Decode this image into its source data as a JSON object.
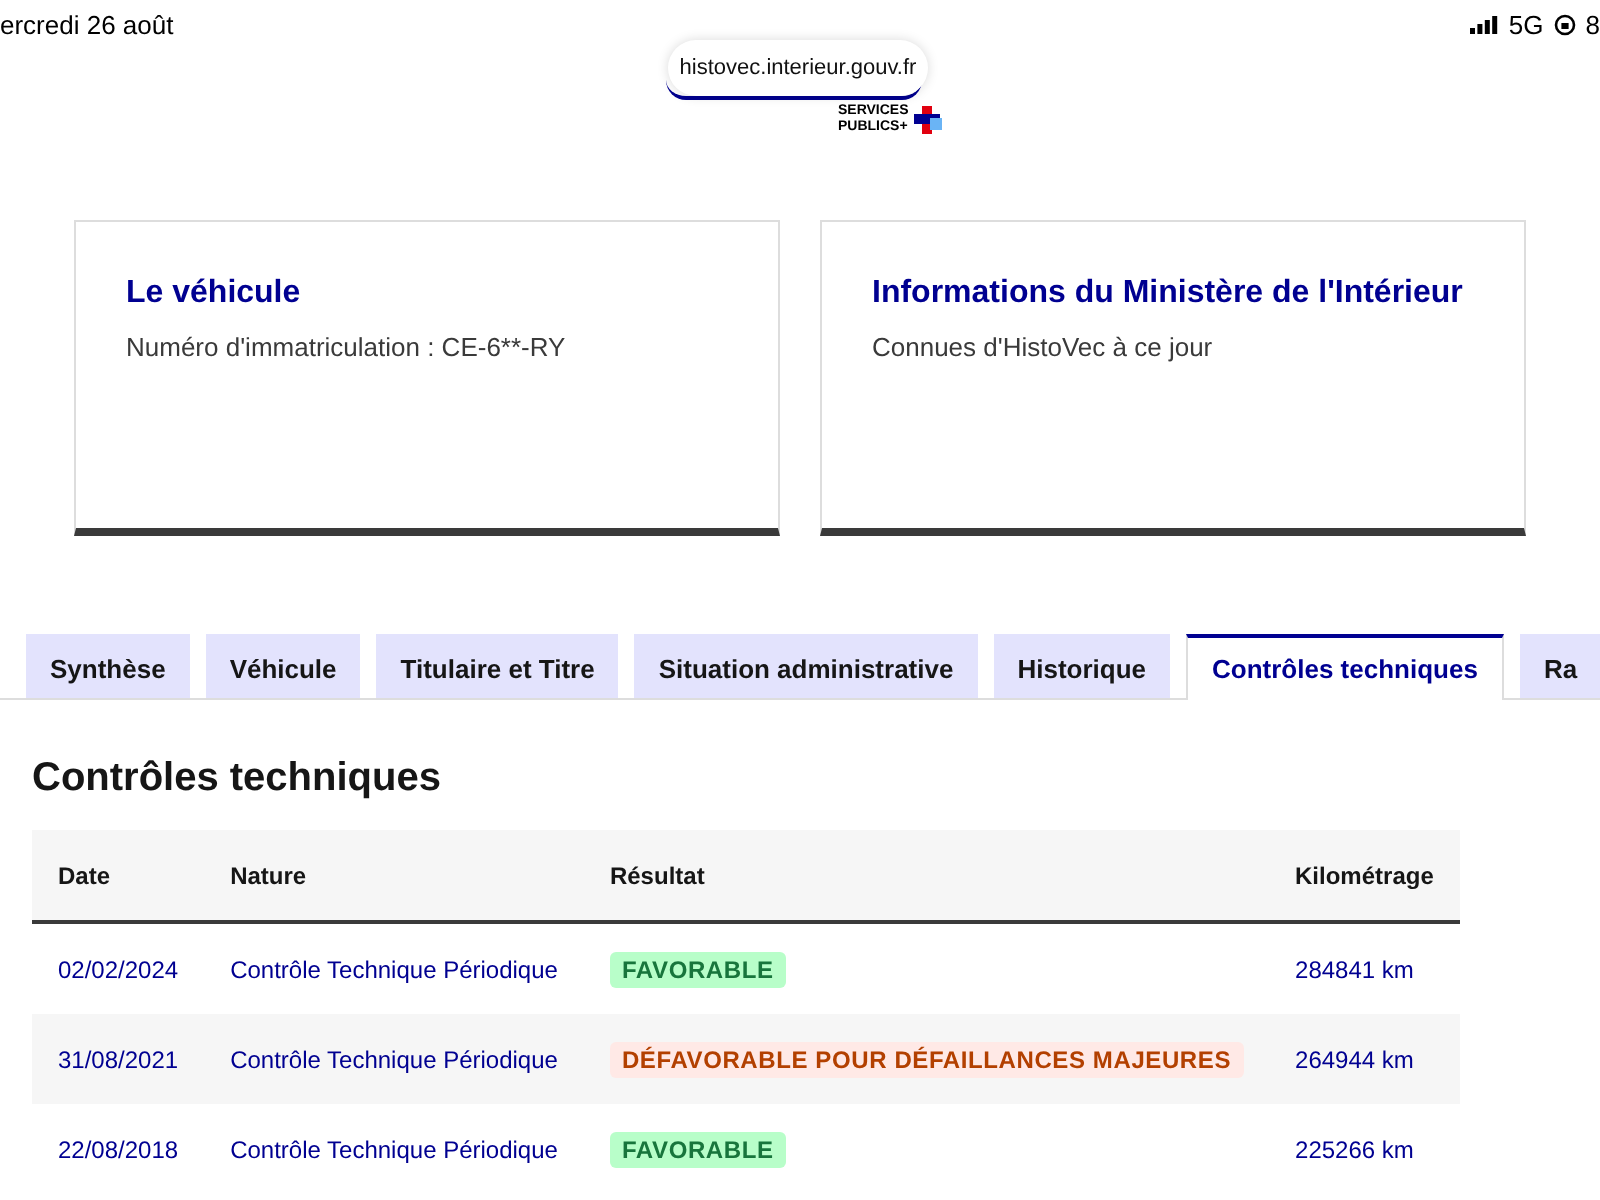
{
  "status_bar": {
    "date": "ercredi 26 août",
    "network": "5G",
    "battery": "8"
  },
  "address_bar": {
    "url": "histovec.interieur.gouv.fr"
  },
  "logo": {
    "line_1": "SERVICES",
    "line_2": "PUBLICS+"
  },
  "cards": [
    {
      "title": "Le véhicule",
      "subtitle": "Numéro d'immatriculation : CE-6**-RY"
    },
    {
      "title": "Informations du Ministère de l'Intérieur",
      "subtitle": "Connues d'HistoVec à ce jour"
    }
  ],
  "tabs": [
    {
      "label": "Synthèse",
      "selected": false
    },
    {
      "label": "Véhicule",
      "selected": false
    },
    {
      "label": "Titulaire et Titre",
      "selected": false
    },
    {
      "label": "Situation administrative",
      "selected": false
    },
    {
      "label": "Historique",
      "selected": false
    },
    {
      "label": "Contrôles techniques",
      "selected": true
    },
    {
      "label": "Ra",
      "selected": false
    }
  ],
  "section": {
    "title": "Contrôles techniques"
  },
  "table": {
    "columns": [
      "Date",
      "Nature",
      "Résultat",
      "Kilométrage"
    ],
    "rows": [
      {
        "date": "02/02/2024",
        "nature": "Contrôle Technique Périodique",
        "result": {
          "label": "FAVORABLE",
          "kind": "favorable"
        },
        "mileage": "284841 km"
      },
      {
        "date": "31/08/2021",
        "nature": "Contrôle Technique Périodique",
        "result": {
          "label": "DÉFAVORABLE POUR DÉFAILLANCES MAJEURES",
          "kind": "unfavorable"
        },
        "mileage": "264944 km"
      },
      {
        "date": "22/08/2018",
        "nature": "Contrôle Technique Périodique",
        "result": {
          "label": "FAVORABLE",
          "kind": "favorable"
        },
        "mileage": "225266 km"
      }
    ]
  }
}
